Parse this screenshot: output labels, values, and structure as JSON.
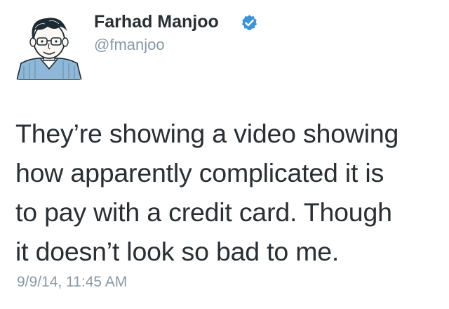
{
  "user": {
    "display_name": "Farhad Manjoo",
    "handle": "@fmanjoo",
    "verified": true,
    "verified_color": "#3b94d9"
  },
  "tweet": {
    "text_lines": [
      "They’re showing a video showing",
      "how apparently complicated it is",
      "to pay with a credit card. Though",
      "it doesn’t look so bad to me."
    ],
    "timestamp": "9/9/14, 11:45 AM"
  },
  "colors": {
    "text": "#292f33",
    "secondary": "#8899a6",
    "background": "#ffffff"
  },
  "icons": {
    "avatar": "avatar-illustration",
    "verified": "verified-badge-icon"
  }
}
